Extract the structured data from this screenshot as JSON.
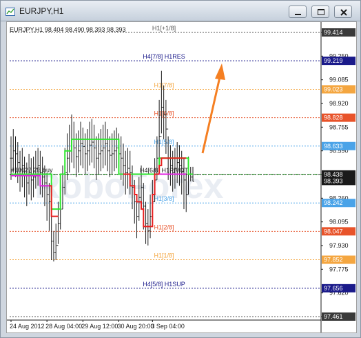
{
  "window": {
    "title": "EURJPY,H1",
    "icon_name": "chart-window-icon",
    "buttons": [
      "minimize-icon",
      "maximize-icon",
      "close-icon"
    ]
  },
  "chart_data": {
    "type": "candlestick-with-levels",
    "symbol_header": "EURJPY,H1  98.404 98.490 98.393 98.393",
    "watermark": "RoboForex",
    "y_axis_ticks": [
      "99.414",
      "99.250",
      "99.085",
      "98.920",
      "98.755",
      "98.590",
      "98.425",
      "98.260",
      "98.095",
      "97.930",
      "97.775",
      "97.620",
      "97.461"
    ],
    "x_axis_ticks": [
      "24 Aug 2012",
      "28 Aug 04:00",
      "29 Aug 12:00",
      "30 Aug 20:00",
      "3 Sep 04:00"
    ],
    "ylim": [
      97.461,
      99.414
    ],
    "levels": [
      {
        "label": "H1[+1/8]",
        "value": 99.414,
        "price_tag": "99.414",
        "color": "#555555",
        "label_color": "#555555",
        "tag_bg": "#3a3a3a"
      },
      {
        "label": "H4[7/8] H1RES",
        "value": 99.219,
        "price_tag": "99.219",
        "color": "#1a1a8a",
        "label_color": "#1a1a8a",
        "tag_bg": "#1a1a8a"
      },
      {
        "label": "H1[7/8]",
        "value": 99.023,
        "price_tag": "99.023",
        "color": "#f4a640",
        "label_color": "#f4a640",
        "tag_bg": "#f4a640"
      },
      {
        "label": "H1[6/8]",
        "value": 98.828,
        "price_tag": "98.828",
        "color": "#e8532a",
        "label_color": "#e8532a",
        "tag_bg": "#e8532a"
      },
      {
        "label": "H1[5/8]",
        "value": 98.633,
        "price_tag": "98.633",
        "color": "#4aa3e8",
        "label_color": "#4aa3e8",
        "tag_bg": "#4aa3e8"
      },
      {
        "label": "H4[6/8] H1PIVOT",
        "value": 98.438,
        "price_tag": "98.438",
        "color": "#1a1a1a",
        "label_color": "#1a1a1a",
        "tag_bg": "#1a1a1a"
      },
      {
        "label": "H1[3/8]",
        "value": 98.242,
        "price_tag": "98.242",
        "color": "#4aa3e8",
        "label_color": "#4aa3e8",
        "tag_bg": "#4aa3e8"
      },
      {
        "label": "H1[2/8]",
        "value": 98.047,
        "price_tag": "98.047",
        "color": "#e8532a",
        "label_color": "#e8532a",
        "tag_bg": "#e8532a"
      },
      {
        "label": "H1[1/8]",
        "value": 97.852,
        "price_tag": "97.852",
        "color": "#f4a640",
        "label_color": "#f4a640",
        "tag_bg": "#f4a640"
      },
      {
        "label": "H4[5/8] H1SUP",
        "value": 97.656,
        "price_tag": "97.656",
        "color": "#1a1a8a",
        "label_color": "#1a1a8a",
        "tag_bg": "#1a1a8a"
      },
      {
        "label": "",
        "value": 97.461,
        "price_tag": "97.461",
        "color": "#555555",
        "label_color": "#555555",
        "tag_bg": "#3a3a3a"
      }
    ],
    "current_price": {
      "value": 98.393,
      "price_tag": "98.393",
      "tag_bg": "#1a1a1a"
    },
    "buy_order": {
      "label": "#10127 2B buy",
      "value": 98.44,
      "color": "#1a8a1a"
    },
    "bar_closes": [
      98.55,
      98.6,
      98.58,
      98.52,
      98.47,
      98.5,
      98.43,
      98.38,
      98.45,
      98.4,
      98.42,
      98.48,
      98.5,
      98.45,
      98.42,
      98.38,
      98.3,
      98.25,
      97.98,
      97.9,
      97.95,
      98.1,
      98.2,
      98.35,
      98.45,
      98.55,
      98.6,
      98.68,
      98.62,
      98.56,
      98.6,
      98.65,
      98.63,
      98.58,
      98.6,
      98.64,
      98.66,
      98.62,
      98.55,
      98.58,
      98.6,
      98.62,
      98.65,
      98.6,
      98.57,
      98.58,
      98.6,
      98.62,
      98.58,
      98.55,
      98.5,
      98.45,
      98.48,
      98.45,
      98.35,
      98.25,
      98.15,
      98.28,
      98.35,
      98.22,
      98.1,
      98.05,
      98.15,
      98.25,
      98.4,
      98.55,
      98.7,
      98.9,
      98.85,
      98.75,
      98.55,
      98.5,
      98.45,
      98.48,
      98.52,
      98.5,
      98.46,
      98.4,
      98.3,
      98.44,
      98.42,
      98.39
    ],
    "bar_highs": [
      98.7,
      98.75,
      98.7,
      98.66,
      98.6,
      98.62,
      98.56,
      98.52,
      98.58,
      98.55,
      98.56,
      98.6,
      98.62,
      98.6,
      98.56,
      98.5,
      98.45,
      98.38,
      98.15,
      98.05,
      98.1,
      98.25,
      98.35,
      98.5,
      98.62,
      98.72,
      98.78,
      98.85,
      98.8,
      98.72,
      98.74,
      98.8,
      98.76,
      98.72,
      98.75,
      98.8,
      98.82,
      98.78,
      98.7,
      98.72,
      98.75,
      98.78,
      98.8,
      98.75,
      98.7,
      98.72,
      98.74,
      98.76,
      98.72,
      98.7,
      98.65,
      98.6,
      98.62,
      98.6,
      98.5,
      98.4,
      98.3,
      98.42,
      98.5,
      98.38,
      98.25,
      98.2,
      98.3,
      98.4,
      98.55,
      98.7,
      98.95,
      99.15,
      99.05,
      98.95,
      98.7,
      98.64,
      98.6,
      98.62,
      98.66,
      98.64,
      98.6,
      98.55,
      98.45,
      98.56,
      98.49,
      98.49
    ],
    "bar_lows": [
      98.4,
      98.45,
      98.42,
      98.38,
      98.32,
      98.35,
      98.28,
      98.22,
      98.3,
      98.26,
      98.28,
      98.34,
      98.36,
      98.3,
      98.28,
      98.22,
      98.12,
      98.05,
      97.85,
      97.84,
      97.85,
      97.96,
      98.06,
      98.2,
      98.3,
      98.4,
      98.45,
      98.52,
      98.48,
      98.42,
      98.45,
      98.5,
      98.48,
      98.44,
      98.46,
      98.5,
      98.52,
      98.48,
      98.4,
      98.44,
      98.46,
      98.48,
      98.5,
      98.46,
      98.42,
      98.44,
      98.46,
      98.48,
      98.44,
      98.4,
      98.36,
      98.3,
      98.34,
      98.3,
      98.2,
      98.1,
      98.0,
      98.12,
      98.2,
      98.06,
      97.96,
      97.95,
      98.0,
      98.1,
      98.25,
      98.4,
      98.55,
      98.72,
      98.68,
      98.58,
      98.4,
      98.36,
      98.32,
      98.34,
      98.38,
      98.36,
      98.3,
      98.2,
      98.18,
      98.3,
      98.39,
      98.39
    ],
    "indicator_green": [
      98.44,
      98.44,
      98.44,
      98.44,
      98.44,
      98.44,
      98.44,
      98.44,
      98.44,
      98.44,
      98.44,
      98.44,
      98.44,
      98.44,
      98.44,
      98.44,
      98.44,
      98.44,
      98.2,
      98.2,
      98.2,
      98.2,
      98.44,
      98.44,
      98.6,
      98.6,
      98.6,
      98.68,
      98.68,
      98.68,
      98.68,
      98.68,
      98.68,
      98.68,
      98.68,
      98.68,
      98.68,
      98.68,
      98.68,
      98.68,
      98.68,
      98.68,
      98.68,
      98.68,
      98.68,
      98.68,
      98.68,
      98.68,
      98.44,
      98.44,
      98.44,
      98.44,
      98.44,
      98.44,
      98.44,
      98.44,
      98.44,
      98.44,
      98.44,
      98.44,
      98.44,
      98.44,
      98.44,
      98.44,
      98.44,
      98.44,
      98.55,
      98.55,
      98.55,
      98.55,
      98.55,
      98.55,
      98.55,
      98.55,
      98.55,
      98.55,
      98.55,
      98.55,
      98.55,
      98.44,
      98.44,
      98.44
    ],
    "indicator_red": [
      null,
      null,
      null,
      null,
      null,
      null,
      null,
      null,
      null,
      null,
      null,
      null,
      null,
      null,
      null,
      null,
      null,
      98.36,
      98.15,
      98.15,
      98.15,
      98.15,
      null,
      null,
      null,
      null,
      null,
      null,
      null,
      null,
      null,
      null,
      null,
      null,
      null,
      null,
      null,
      null,
      null,
      null,
      null,
      null,
      null,
      null,
      null,
      null,
      null,
      null,
      null,
      null,
      98.44,
      98.44,
      98.44,
      98.36,
      98.36,
      98.3,
      98.25,
      98.25,
      98.2,
      98.08,
      98.08,
      98.08,
      98.08,
      98.3,
      98.44,
      98.44,
      98.5,
      98.55,
      98.55,
      98.55,
      98.55,
      98.55,
      98.55,
      98.55,
      98.55,
      98.55,
      98.55,
      98.55,
      98.55,
      null,
      null,
      null
    ],
    "indicator_magenta": [
      98.43,
      98.43,
      98.43,
      98.43,
      98.43,
      98.43,
      98.43,
      98.43,
      98.43,
      98.43,
      98.43,
      98.43,
      98.43,
      98.36,
      98.36,
      98.36,
      98.36,
      98.36,
      null,
      null,
      null,
      null,
      null,
      null,
      null,
      null,
      null,
      null,
      null,
      null,
      null,
      null,
      null,
      null,
      null,
      null,
      null,
      null,
      null,
      null,
      null,
      null,
      null,
      null,
      null,
      null,
      null,
      null,
      null,
      null,
      null,
      null,
      null,
      null,
      null,
      null,
      null,
      null,
      null,
      null,
      null,
      null,
      null,
      null,
      null,
      null,
      98.44,
      98.44,
      98.44,
      98.44,
      98.44,
      98.44,
      98.44,
      98.44,
      98.44,
      98.44,
      98.44,
      98.44,
      98.44,
      null,
      null,
      null
    ],
    "arrow": {
      "color": "#f57f22",
      "direction": "up-right"
    }
  }
}
